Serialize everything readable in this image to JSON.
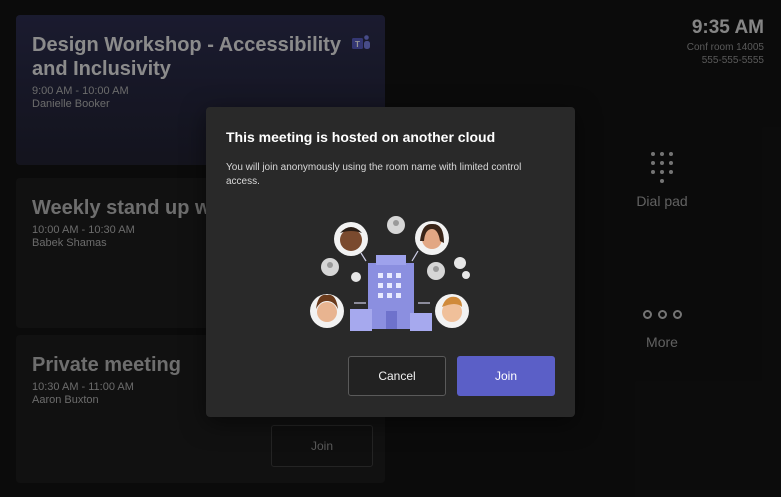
{
  "cards": [
    {
      "title": "Design Workshop - Accessibility and Inclusivity",
      "time": "9:00 AM - 10:00 AM",
      "organizer": "Danielle Booker"
    },
    {
      "title": "Weekly stand up with",
      "time": "10:00 AM - 10:30 AM",
      "organizer": "Babek Shamas"
    },
    {
      "title": "Private meeting",
      "time": "10:30 AM - 11:00 AM",
      "organizer": "Aaron Buxton",
      "join_label": "Join"
    }
  ],
  "status": {
    "time": "9:35 AM",
    "room": "Conf room 14005",
    "phone": "555-555-5555"
  },
  "side": {
    "dialpad_label": "Dial pad",
    "more_label": "More"
  },
  "dialog": {
    "title": "This meeting is hosted on another cloud",
    "body": "You will join anonymously using the room name with limited control access.",
    "cancel_label": "Cancel",
    "join_label": "Join"
  },
  "colors": {
    "accent": "#5b5fc7",
    "dialog_bg": "#292929",
    "page_bg": "#141414"
  }
}
